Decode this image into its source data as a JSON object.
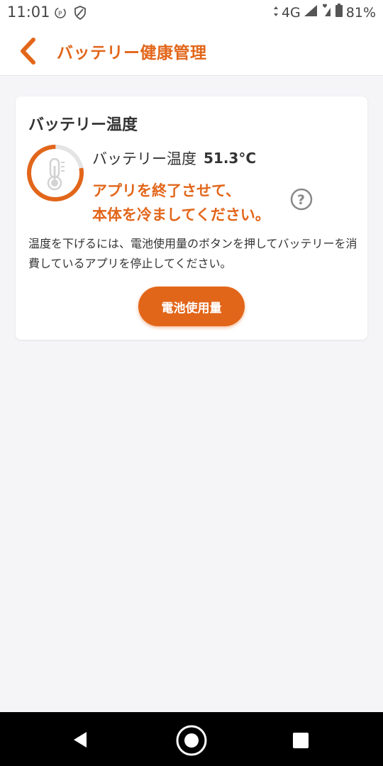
{
  "status_bar": {
    "time": "11:01",
    "network": "4G",
    "battery_percent": "81%",
    "icons": [
      "data-saver-icon",
      "shield-icon",
      "signal-icon",
      "wifi-heart-icon",
      "battery-icon"
    ]
  },
  "header": {
    "title": "バッテリー健康管理",
    "back_icon": "chevron-left-icon"
  },
  "card": {
    "title": "バッテリー温度",
    "temp_label": "バッテリー温度",
    "temp_value": "51.3°C",
    "warning_line1": "アプリを終了させて、",
    "warning_line2": "本体を冷ましてください。",
    "help_icon": "question-icon",
    "description": "温度を下げるには、電池使用量のボタンを押してバッテリーを消費しているアプリを停止してください。",
    "button_label": "電池使用量",
    "gauge_fraction": 0.78
  },
  "nav": {
    "icons": [
      "nav-back-icon",
      "nav-home-icon",
      "nav-recent-icon"
    ]
  },
  "colors": {
    "accent": "#e2661a",
    "background": "#f5f5f8",
    "card": "#ffffff"
  }
}
